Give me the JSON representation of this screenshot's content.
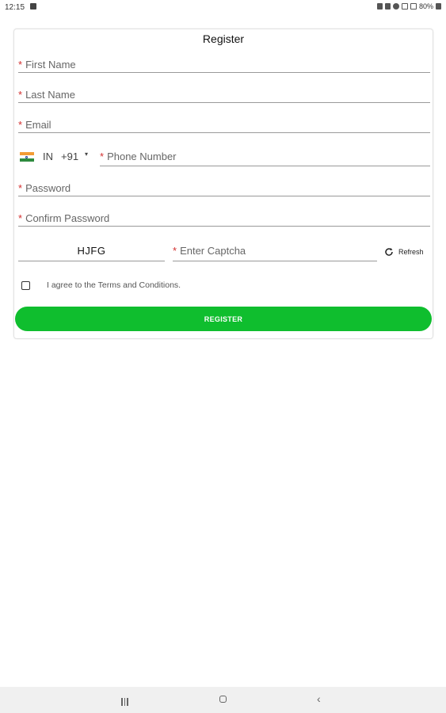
{
  "status_bar": {
    "time": "12:15",
    "battery": "80%",
    "icons": [
      "image-icon",
      "lock-icon",
      "alarm-icon",
      "signal-icon",
      "wifi-icon",
      "battery-icon"
    ]
  },
  "form": {
    "title": "Register",
    "required_marker": "*",
    "fields": {
      "first_name": "First Name",
      "last_name": "Last Name",
      "email": "Email",
      "password": "Password",
      "confirm_password": "Confirm Password"
    },
    "phone": {
      "country_code": "IN",
      "dial_code": "+91",
      "caret": "▾",
      "placeholder": "Phone Number",
      "flag": "india-flag-icon"
    },
    "captcha": {
      "code": "HJFG",
      "placeholder": "Enter Captcha",
      "refresh_label": "Refresh"
    },
    "agree_label": "I agree to the Terms and Conditions.",
    "register_button": "REGISTER"
  },
  "colors": {
    "accent": "#0fbe2e",
    "required": "#d32f2f"
  },
  "nav_bar": {
    "icons": [
      "recents-icon",
      "home-icon",
      "back-icon"
    ],
    "back_glyph": "‹"
  }
}
